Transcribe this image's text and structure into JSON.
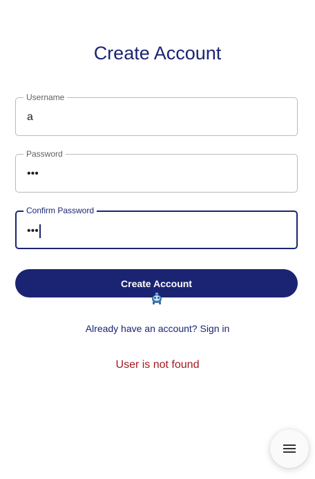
{
  "page": {
    "title": "Create Account"
  },
  "form": {
    "username": {
      "label": "Username",
      "value": "a"
    },
    "password": {
      "label": "Password",
      "value": "•••"
    },
    "confirm_password": {
      "label": "Confirm Password",
      "value": "•••"
    },
    "submit_label": "Create Account",
    "signin_link": "Already have an account? Sign in",
    "error_message": "User is not found"
  },
  "fab": {
    "icon": "menu-icon"
  },
  "colors": {
    "primary": "#1a2472",
    "error": "#a3191f",
    "border": "#b9b9b9"
  }
}
